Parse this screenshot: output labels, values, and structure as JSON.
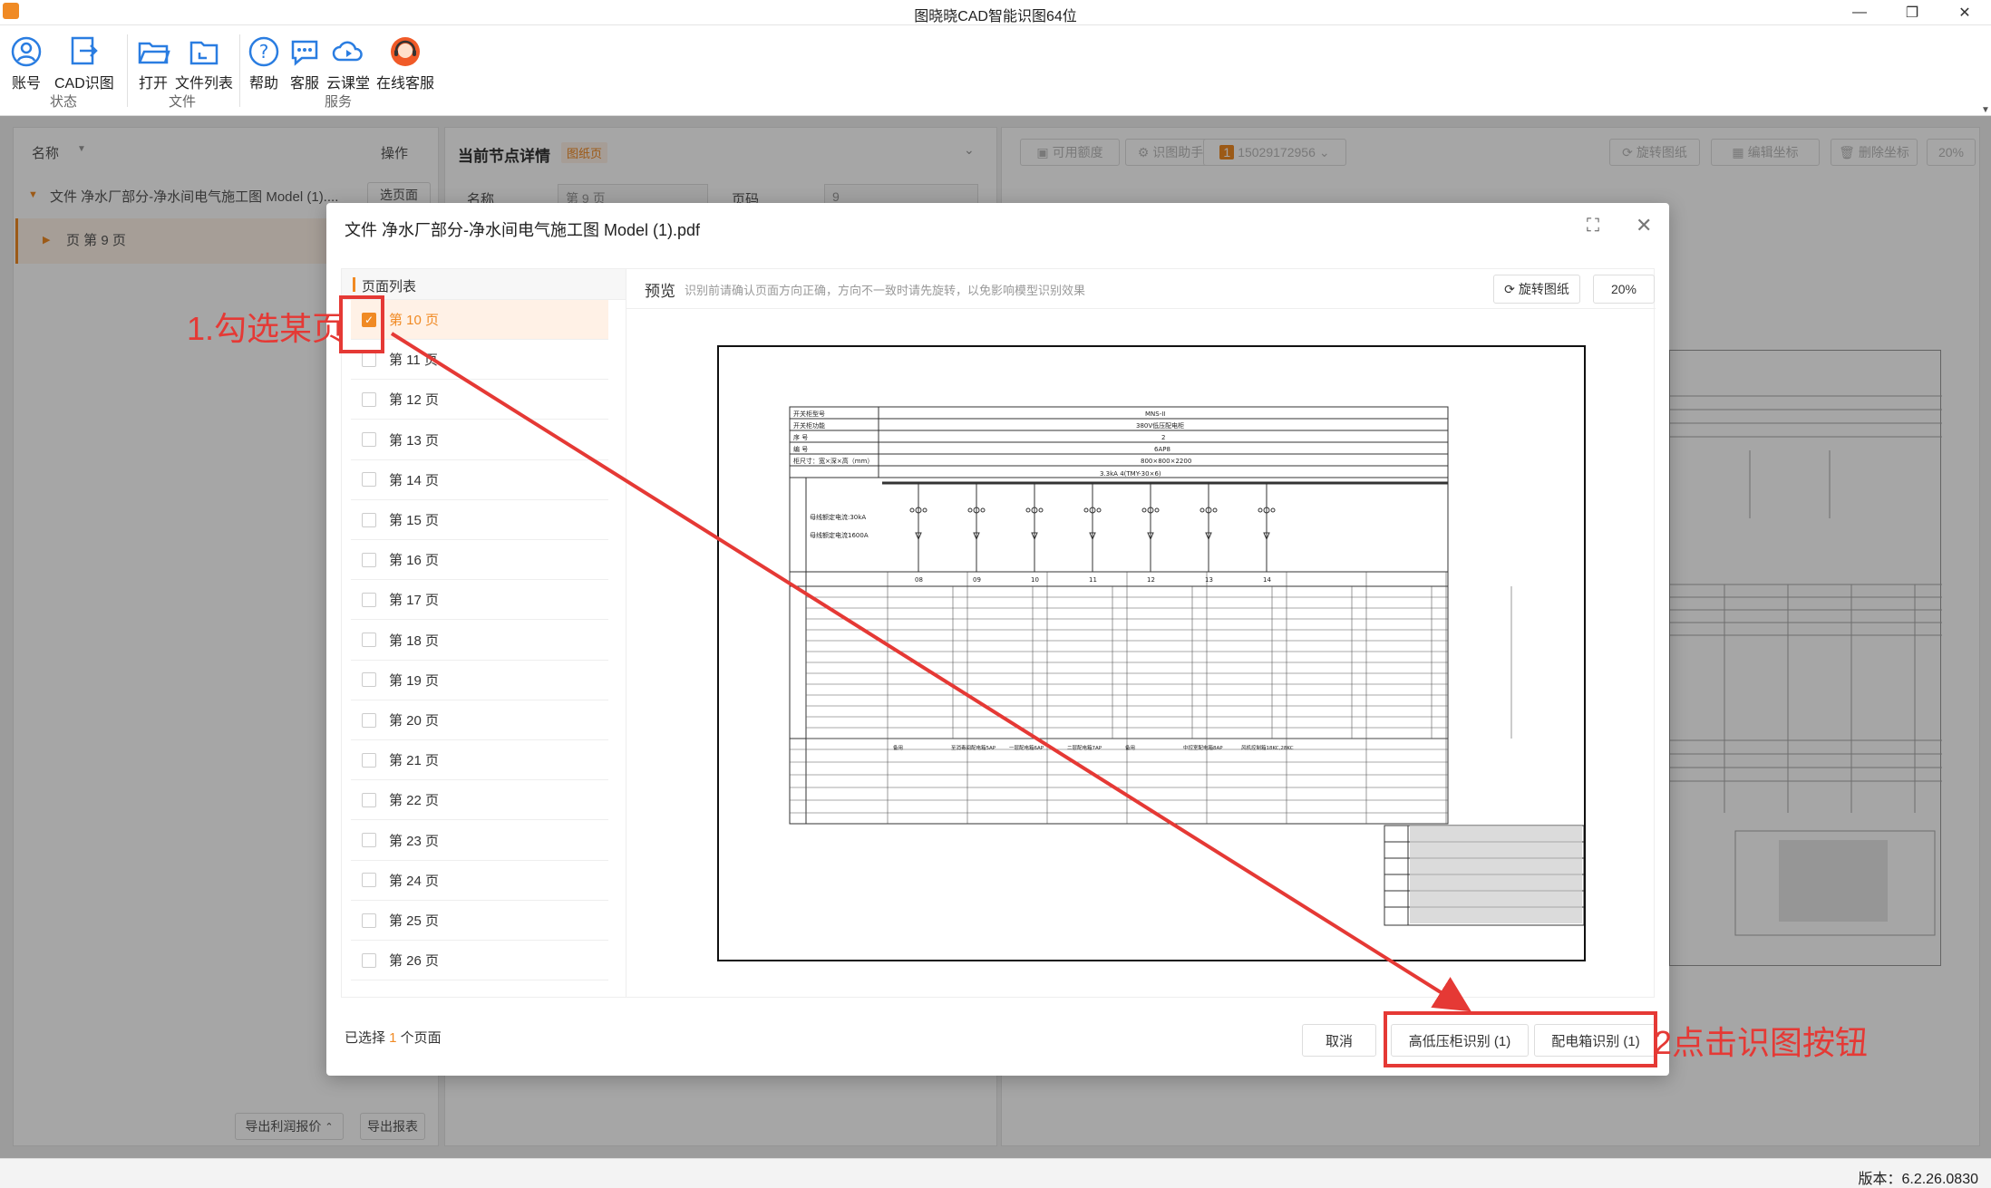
{
  "window": {
    "title": "图晓晓CAD智能识图64位",
    "version": "版本：6.2.26.0830"
  },
  "ribbon": {
    "tools": [
      {
        "label": "账号",
        "icon": "account-icon"
      },
      {
        "label": "CAD识图",
        "icon": "cad-recognize-icon"
      },
      {
        "label": "打开",
        "icon": "open-folder-icon"
      },
      {
        "label": "文件列表",
        "icon": "file-list-icon"
      },
      {
        "label": "帮助",
        "icon": "help-icon"
      },
      {
        "label": "客服",
        "icon": "chat-icon"
      },
      {
        "label": "云课堂",
        "icon": "cloud-class-icon"
      },
      {
        "label": "在线客服",
        "icon": "online-support-icon"
      }
    ],
    "groups": [
      "状态",
      "文件",
      "服务"
    ]
  },
  "left_panel": {
    "col_name": "名称",
    "col_action": "操作",
    "file_row": "文件  净水厂部分-净水间电气施工图 Model (1)....",
    "file_action": "选页面",
    "page_row": "页  第 9 页",
    "export_quote": "导出利润报价",
    "export_report": "导出报表"
  },
  "middle_panel": {
    "title": "当前节点详情",
    "badge": "图纸页",
    "field_name_label": "名称",
    "field_name_value": "第 9 页",
    "field_page_label": "页码",
    "field_page_value": "9"
  },
  "right_toolbar": {
    "quota": "可用额度",
    "assistant": "识图助手",
    "account_badge": "1",
    "phone": "15029172956",
    "rotate": "旋转图纸",
    "edit_coords": "编辑坐标",
    "delete_coords": "删除坐标",
    "zoom": "20%"
  },
  "modal": {
    "title": "文件  净水厂部分-净水间电气施工图 Model (1).pdf",
    "list_title": "页面列表",
    "pages": [
      {
        "label": "第 10 页",
        "checked": true
      },
      {
        "label": "第 11 页",
        "checked": false
      },
      {
        "label": "第 12 页",
        "checked": false
      },
      {
        "label": "第 13 页",
        "checked": false
      },
      {
        "label": "第 14 页",
        "checked": false
      },
      {
        "label": "第 15 页",
        "checked": false
      },
      {
        "label": "第 16 页",
        "checked": false
      },
      {
        "label": "第 17 页",
        "checked": false
      },
      {
        "label": "第 18 页",
        "checked": false
      },
      {
        "label": "第 19 页",
        "checked": false
      },
      {
        "label": "第 20 页",
        "checked": false
      },
      {
        "label": "第 21 页",
        "checked": false
      },
      {
        "label": "第 22 页",
        "checked": false
      },
      {
        "label": "第 23 页",
        "checked": false
      },
      {
        "label": "第 24 页",
        "checked": false
      },
      {
        "label": "第 25 页",
        "checked": false
      },
      {
        "label": "第 26 页",
        "checked": false
      }
    ],
    "preview_title": "预览",
    "preview_hint": "识别前请确认页面方向正确，方向不一致时请先旋转，以免影响模型识别效果",
    "rotate_label": "旋转图纸",
    "zoom": "20%",
    "selected_prefix": "已选择 ",
    "selected_count": "1",
    "selected_suffix": " 个页面",
    "cancel_label": "取消",
    "hv_cabinet_label": "高低压柜识别 (1)",
    "distribution_box_label": "配电箱识别 (1)"
  },
  "annotations": {
    "step1": "1.勾选某页",
    "step2": "2点击识图按钮",
    "color": "#e53935"
  },
  "drawing": {
    "header_rows": [
      "开关柜型号",
      "开关柜功能",
      "序   号",
      "编   号",
      "柜尺寸：宽×深×高（mm）"
    ],
    "header_values": [
      "MNS-II",
      "380V低压配电柜",
      "2",
      "6AP8",
      "800×800×2200"
    ],
    "busbar": "3.3kA  4(TMY-30×6)",
    "side_notes": [
      "母线额定电流:30kA",
      "母线额定电流1600A"
    ],
    "circuit_ids": [
      "08",
      "09",
      "10",
      "11",
      "12",
      "13",
      "14"
    ],
    "circuit_names": [
      "备用",
      "至消毒间配电箱5AP",
      "一层配电箱6AP",
      "二层配电箱7AP",
      "备用",
      "中控室配电箱8AP",
      "风机控制箱18KC,28KC"
    ]
  }
}
